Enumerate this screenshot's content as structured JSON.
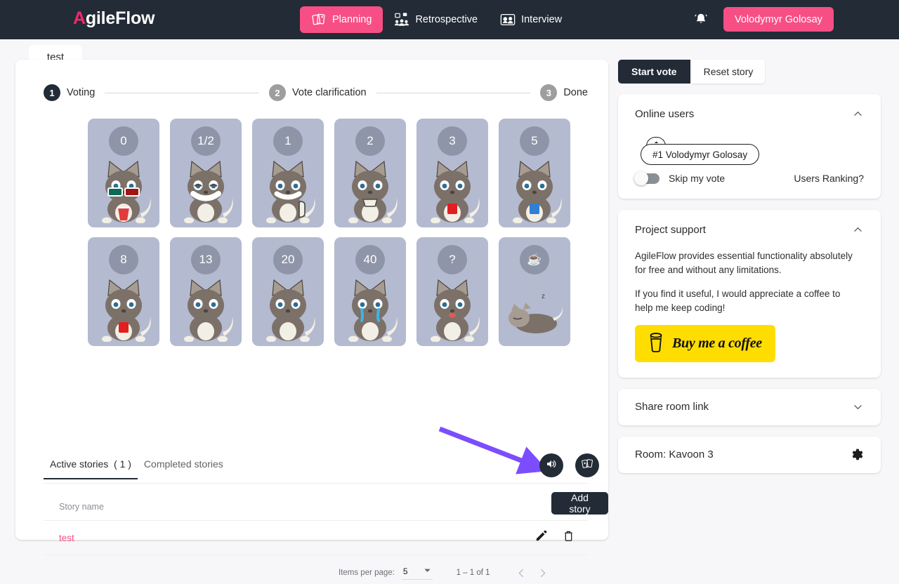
{
  "topnav": {
    "brand": "AgileFlow",
    "brand_mark": "A",
    "brand_rest": "gileFlow",
    "items": [
      {
        "label": "Planning",
        "icon": "planning-cards-icon",
        "active": true
      },
      {
        "label": "Retrospective",
        "icon": "retrospective-board-icon",
        "active": false
      },
      {
        "label": "Interview",
        "icon": "interview-people-icon",
        "active": false
      }
    ],
    "notifications_icon": "bell-icon",
    "user_label": "Volodymyr Golosay"
  },
  "story_tab": {
    "label": "test"
  },
  "stepper": {
    "steps": [
      {
        "num": "1",
        "label": "Voting",
        "state": "active"
      },
      {
        "num": "2",
        "label": "Vote clarification",
        "state": "inactive"
      },
      {
        "num": "3",
        "label": "Done",
        "state": "inactive"
      }
    ]
  },
  "cards": [
    {
      "value": "0",
      "mascot": "cat-3d-glasses-popcorn"
    },
    {
      "value": "1/2",
      "mascot": "cat-grinning-eyes-closed"
    },
    {
      "value": "1",
      "mascot": "cat-thumbs-up"
    },
    {
      "value": "2",
      "mascot": "cat-eating-snack"
    },
    {
      "value": "3",
      "mascot": "cat-holding-red-can"
    },
    {
      "value": "5",
      "mascot": "cat-holding-blue-cup"
    },
    {
      "value": "8",
      "mascot": "cat-holding-red-heart"
    },
    {
      "value": "13",
      "mascot": "cat-sitting-wide-eyes"
    },
    {
      "value": "20",
      "mascot": "cat-sitting-tired"
    },
    {
      "value": "40",
      "mascot": "cat-crying-tears"
    },
    {
      "value": "?",
      "mascot": "cat-confused-tongue"
    },
    {
      "value": "☕",
      "mascot": "cat-sleeping"
    }
  ],
  "action_buttons": [
    {
      "name": "sound-toggle",
      "icon": "volume-icon"
    },
    {
      "name": "show-cards",
      "icon": "cards-deck-icon"
    }
  ],
  "annotation": {
    "type": "arrow",
    "color": "#7c4dff",
    "points_to": "sound-toggle"
  },
  "stories": {
    "tabs": [
      {
        "label": "Active stories  ( 1 )",
        "active": true
      },
      {
        "label": "Completed stories",
        "active": false
      }
    ],
    "columns": [
      "Story name"
    ],
    "rows": [
      {
        "name": "test",
        "edit_icon": "pencil-icon",
        "delete_icon": "trash-icon"
      }
    ],
    "add_button": "Add story"
  },
  "paginator": {
    "items_per_page_label": "Items per page:",
    "items_per_page_value": "5",
    "range_label": "1 – 1 of 1",
    "prev_icon": "chevron-left-icon",
    "next_icon": "chevron-right-icon"
  },
  "right": {
    "vote_controls": {
      "start": "Start vote",
      "reset": "Reset story"
    },
    "online_users": {
      "title": "Online users",
      "collapse_icon": "chevron-up-icon",
      "users": [
        {
          "label": "#1 Volodymyr Golosay",
          "badge_icon": "home-icon"
        }
      ],
      "skip_vote_label": "Skip my vote",
      "skip_vote_on": false,
      "ranking_link": "Users Ranking?"
    },
    "project_support": {
      "title": "Project support",
      "collapse_icon": "chevron-up-icon",
      "paragraph1": "AgileFlow provides essential functionality absolutely for free and without any limitations.",
      "paragraph2": "If you find it useful, I would appreciate a coffee to help me keep coding!",
      "bmc_label": "Buy me a coffee",
      "bmc_icon": "coffee-cup-icon",
      "bmc_color": "#ffdd00"
    },
    "share_room": {
      "title": "Share room link",
      "expand_icon": "chevron-down-icon"
    },
    "room": {
      "title": "Room: Kavoon 3",
      "settings_icon": "gear-icon"
    }
  },
  "colors": {
    "accent_pink": "#f74f85",
    "dark": "#222b36",
    "card_bg": "#b4bacf",
    "badge_gray": "#8f95a8",
    "annotation_purple": "#7c4dff",
    "page_bg": "#f7f7f9"
  }
}
